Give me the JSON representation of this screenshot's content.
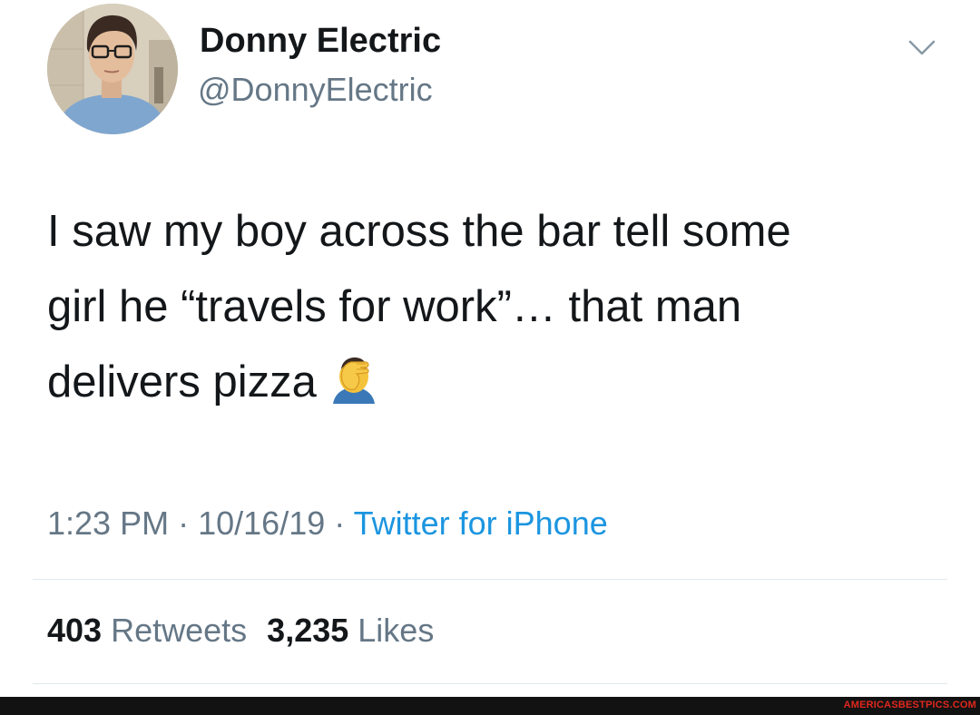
{
  "author": {
    "display_name": "Donny Electric",
    "handle": "@DonnyElectric",
    "avatar_icon": "profile-photo"
  },
  "menu_icon": "chevron-down-icon",
  "tweet": {
    "lines": [
      "I saw my boy across the bar tell some",
      "girl he “travels for work”… that man",
      "delivers pizza"
    ],
    "emoji_icon": "facepalm-icon"
  },
  "meta": {
    "time": "1:23 PM",
    "separator": "·",
    "date": "10/16/19",
    "source": "Twitter for iPhone"
  },
  "stats": {
    "retweets_count": "403",
    "retweets_label": "Retweets",
    "likes_count": "3,235",
    "likes_label": "Likes"
  },
  "watermark": "AMERICASBESTPICS.COM",
  "colors": {
    "text_primary": "#14171a",
    "text_secondary": "#657786",
    "link_blue": "#1b95e0",
    "divider": "#e1e8ed",
    "watermark_red": "#e0281f"
  }
}
